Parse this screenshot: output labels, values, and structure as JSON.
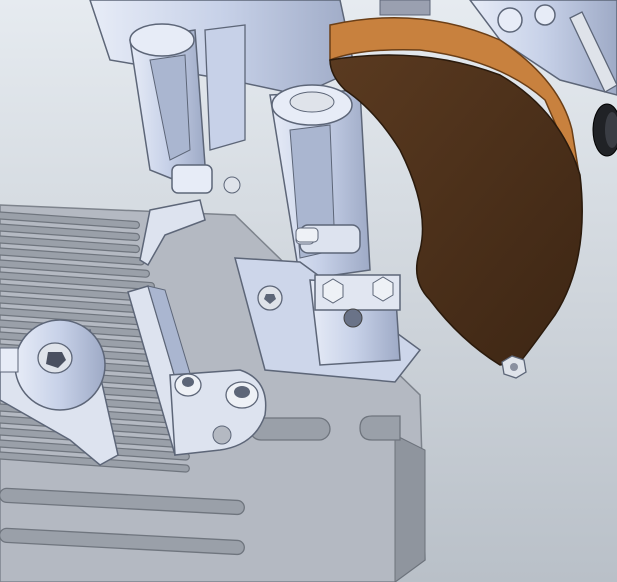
{
  "scene": {
    "background_top": "#e6ebf0",
    "background_bottom": "#b9c0c8",
    "plate_color": "#b4b9c2",
    "plate_edge": "#7d838c",
    "slot_color": "#9aa0a9",
    "part_color": "#cdd6ea",
    "part_shade": "#aab6d0",
    "part_edge": "#5d6678",
    "guard_face": "#4b2f1a",
    "guard_edge_color": "#c8813e",
    "hardware_color": "#dfe3ea",
    "dark_knob": "#202226"
  }
}
